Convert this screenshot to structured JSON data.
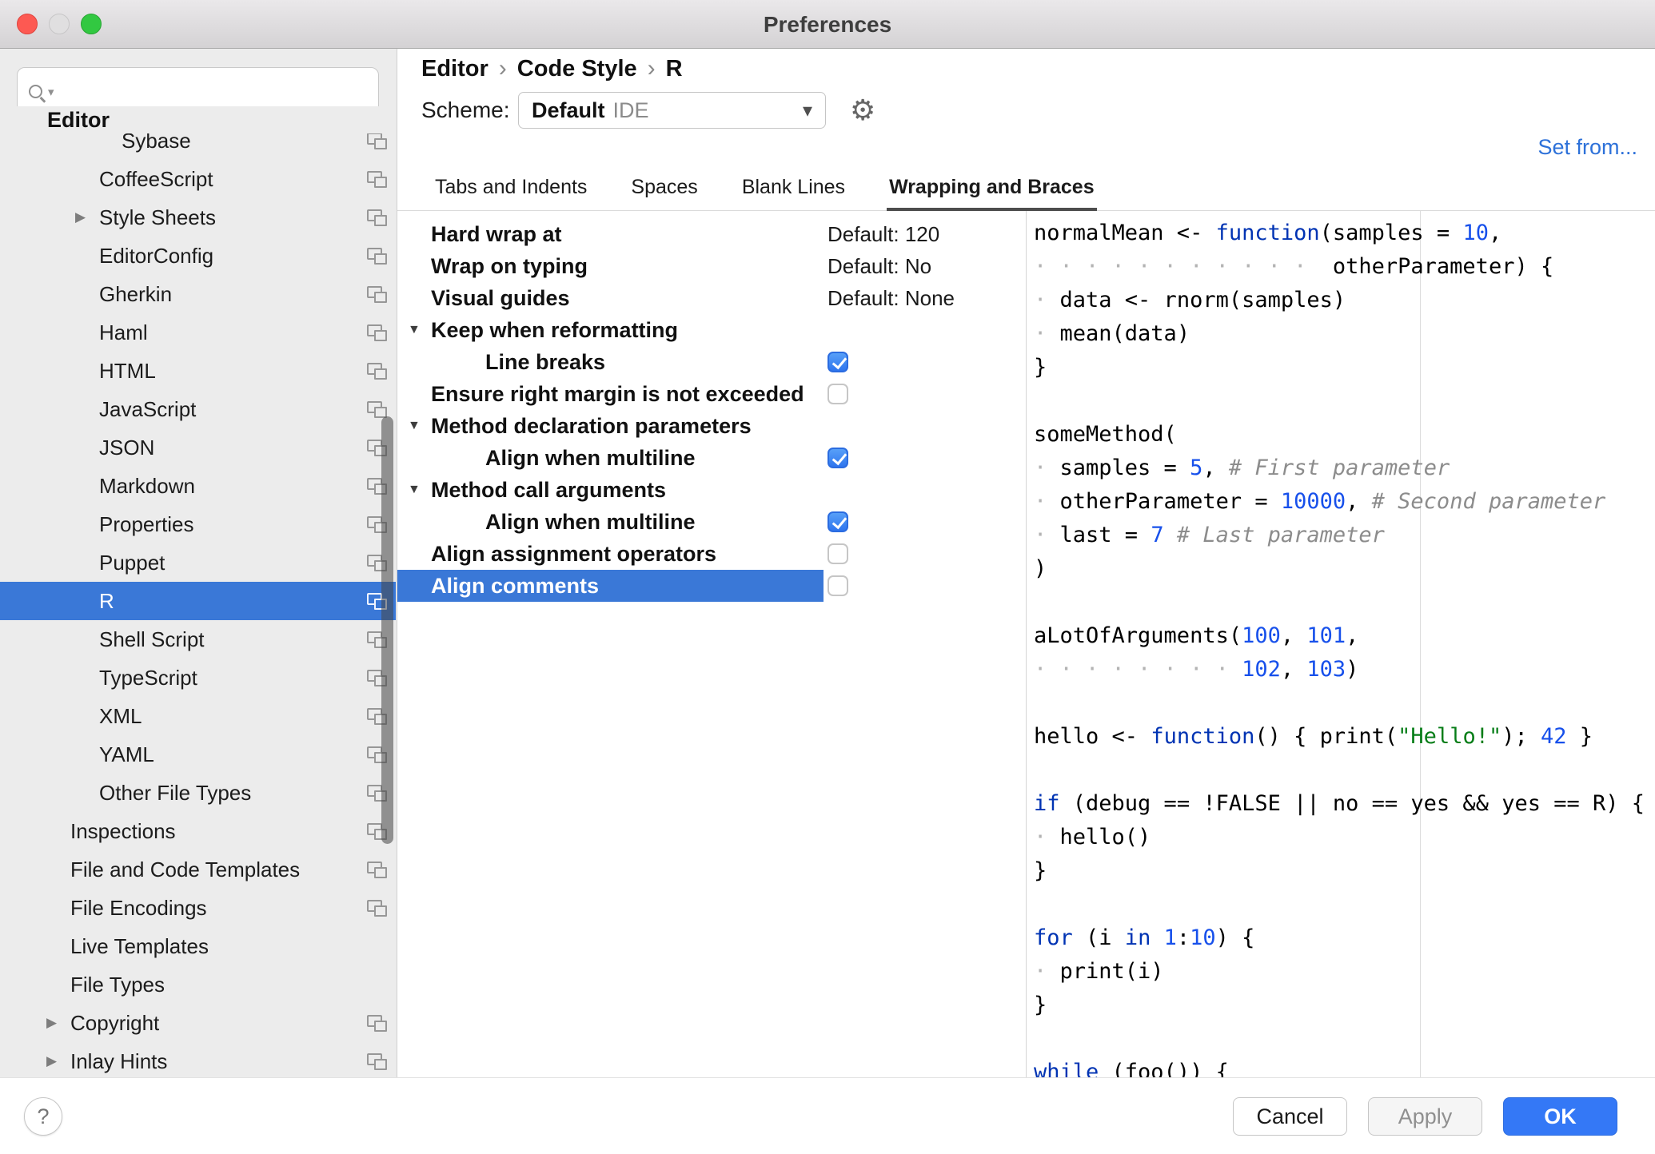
{
  "window": {
    "title": "Preferences"
  },
  "colors": {
    "selection_blue": "#3a78d7",
    "ok_button_blue": "#3478f6",
    "link_blue": "#2d71d9",
    "checkbox_blue": "#2e75ee",
    "code_keyword": "#0033b3",
    "code_number": "#1750eb",
    "code_string": "#067d17",
    "code_comment": "#8c8c8c"
  },
  "icons": {
    "search": "loupe",
    "caret": "▾",
    "gear": "⚙",
    "collapse": "▶",
    "expand": "▼",
    "crumb_sep": "›",
    "badge": "per-language-settings-badge"
  },
  "sidebar": {
    "search_placeholder": "",
    "section": "Editor",
    "items": [
      {
        "label": "Sybase",
        "indent": 2,
        "badge": true
      },
      {
        "label": "CoffeeScript",
        "indent": 1,
        "badge": true
      },
      {
        "label": "Style Sheets",
        "indent": 1,
        "arrow": true,
        "badge": true
      },
      {
        "label": "EditorConfig",
        "indent": 1,
        "badge": true
      },
      {
        "label": "Gherkin",
        "indent": 1,
        "badge": true
      },
      {
        "label": "Haml",
        "indent": 1,
        "badge": true
      },
      {
        "label": "HTML",
        "indent": 1,
        "badge": true
      },
      {
        "label": "JavaScript",
        "indent": 1,
        "badge": true
      },
      {
        "label": "JSON",
        "indent": 1,
        "badge": true
      },
      {
        "label": "Markdown",
        "indent": 1,
        "badge": true
      },
      {
        "label": "Properties",
        "indent": 1,
        "badge": true
      },
      {
        "label": "Puppet",
        "indent": 1,
        "badge": true
      },
      {
        "label": "R",
        "indent": 1,
        "selected": true,
        "badge": true
      },
      {
        "label": "Shell Script",
        "indent": 1,
        "badge": true
      },
      {
        "label": "TypeScript",
        "indent": 1,
        "badge": true
      },
      {
        "label": "XML",
        "indent": 1,
        "badge": true
      },
      {
        "label": "YAML",
        "indent": 1,
        "badge": true
      },
      {
        "label": "Other File Types",
        "indent": 1,
        "badge": true
      },
      {
        "label": "Inspections",
        "indent": 0,
        "badge": true
      },
      {
        "label": "File and Code Templates",
        "indent": 0,
        "badge": true
      },
      {
        "label": "File Encodings",
        "indent": 0,
        "badge": true
      },
      {
        "label": "Live Templates",
        "indent": 0,
        "badge": false
      },
      {
        "label": "File Types",
        "indent": 0,
        "badge": false
      },
      {
        "label": "Copyright",
        "indent": 0,
        "arrow": true,
        "badge": true
      },
      {
        "label": "Inlay Hints",
        "indent": 0,
        "arrow": true,
        "badge": true
      }
    ]
  },
  "header": {
    "breadcrumb": [
      "Editor",
      "Code Style",
      "R"
    ],
    "scheme_label": "Scheme:",
    "scheme_value": "Default",
    "scheme_suffix": "IDE",
    "set_from": "Set from..."
  },
  "tabs": [
    {
      "label": "Tabs and Indents"
    },
    {
      "label": "Spaces"
    },
    {
      "label": "Blank Lines"
    },
    {
      "label": "Wrapping and Braces",
      "active": true
    }
  ],
  "settings": [
    {
      "label": "Hard wrap at",
      "type": "value",
      "value": "Default: 120"
    },
    {
      "label": "Wrap on typing",
      "type": "value",
      "value": "Default: No"
    },
    {
      "label": "Visual guides",
      "type": "value",
      "value": "Default: None"
    },
    {
      "label": "Keep when reformatting",
      "type": "group"
    },
    {
      "label": "Line breaks",
      "type": "checkbox",
      "checked": true,
      "child": true
    },
    {
      "label": "Ensure right margin is not exceeded",
      "type": "checkbox",
      "checked": false
    },
    {
      "label": "Method declaration parameters",
      "type": "group"
    },
    {
      "label": "Align when multiline",
      "type": "checkbox",
      "checked": true,
      "child": true
    },
    {
      "label": "Method call arguments",
      "type": "group"
    },
    {
      "label": "Align when multiline",
      "type": "checkbox",
      "checked": true,
      "child": true
    },
    {
      "label": "Align assignment operators",
      "type": "checkbox",
      "checked": false
    },
    {
      "label": "Align comments",
      "type": "checkbox",
      "checked": false,
      "selected": true
    }
  ],
  "code": {
    "lines": [
      [
        [
          "p",
          "normalMean <- "
        ],
        [
          "k",
          "function"
        ],
        [
          "p",
          "(samples = "
        ],
        [
          "n",
          "10"
        ],
        [
          "p",
          ","
        ]
      ],
      [
        [
          "w",
          "· · · · · · · · · · ·  "
        ],
        [
          "p",
          "otherParameter) {"
        ]
      ],
      [
        [
          "w",
          "· "
        ],
        [
          "p",
          "data <- rnorm(samples)"
        ]
      ],
      [
        [
          "w",
          "· "
        ],
        [
          "p",
          "mean(data)"
        ]
      ],
      [
        [
          "p",
          "}"
        ]
      ],
      [],
      [
        [
          "p",
          "someMethod("
        ]
      ],
      [
        [
          "w",
          "· "
        ],
        [
          "p",
          "samples = "
        ],
        [
          "n",
          "5"
        ],
        [
          "p",
          ", "
        ],
        [
          "c",
          "# First parameter"
        ]
      ],
      [
        [
          "w",
          "· "
        ],
        [
          "p",
          "otherParameter = "
        ],
        [
          "n",
          "10000"
        ],
        [
          "p",
          ", "
        ],
        [
          "c",
          "# Second parameter"
        ]
      ],
      [
        [
          "w",
          "· "
        ],
        [
          "p",
          "last = "
        ],
        [
          "n",
          "7"
        ],
        [
          "p",
          " "
        ],
        [
          "c",
          "# Last parameter"
        ]
      ],
      [
        [
          "p",
          ")"
        ]
      ],
      [],
      [
        [
          "p",
          "aLotOfArguments("
        ],
        [
          "n",
          "100"
        ],
        [
          "p",
          ", "
        ],
        [
          "n",
          "101"
        ],
        [
          "p",
          ","
        ]
      ],
      [
        [
          "w",
          "· · · · · · · · "
        ],
        [
          "n",
          "102"
        ],
        [
          "p",
          ", "
        ],
        [
          "n",
          "103"
        ],
        [
          "p",
          ")"
        ]
      ],
      [],
      [
        [
          "p",
          "hello <- "
        ],
        [
          "k",
          "function"
        ],
        [
          "p",
          "() { print("
        ],
        [
          "s",
          "\"Hello!\""
        ],
        [
          "p",
          "); "
        ],
        [
          "n",
          "42"
        ],
        [
          "p",
          " }"
        ]
      ],
      [],
      [
        [
          "k",
          "if"
        ],
        [
          "p",
          " (debug == !FALSE || no == yes && yes == R) {"
        ]
      ],
      [
        [
          "w",
          "· "
        ],
        [
          "p",
          "hello()"
        ]
      ],
      [
        [
          "p",
          "}"
        ]
      ],
      [],
      [
        [
          "k",
          "for"
        ],
        [
          "p",
          " (i "
        ],
        [
          "k",
          "in"
        ],
        [
          "p",
          " "
        ],
        [
          "n",
          "1"
        ],
        [
          "p",
          ":"
        ],
        [
          "n",
          "10"
        ],
        [
          "p",
          ") {"
        ]
      ],
      [
        [
          "w",
          "· "
        ],
        [
          "p",
          "print(i)"
        ]
      ],
      [
        [
          "p",
          "}"
        ]
      ],
      [],
      [
        [
          "k",
          "while"
        ],
        [
          "p",
          " (foo()) {"
        ]
      ]
    ]
  },
  "footer": {
    "help": "?",
    "cancel": "Cancel",
    "apply": "Apply",
    "ok": "OK"
  }
}
